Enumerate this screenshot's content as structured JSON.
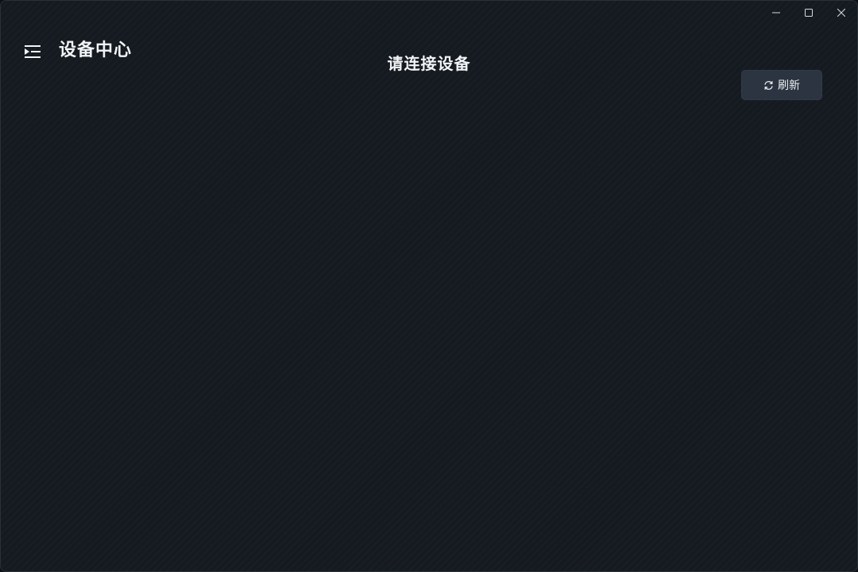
{
  "window": {
    "caption": {
      "minimize_icon": "minimize-icon",
      "maximize_icon": "maximize-icon",
      "close_icon": "close-icon"
    }
  },
  "header": {
    "menu_icon": "menu-expand-icon",
    "app_title": "设备中心"
  },
  "main": {
    "status_heading": "请连接设备",
    "refresh_button": {
      "icon": "refresh-icon",
      "label": "刷新"
    }
  },
  "colors": {
    "background": "#141a20",
    "button": "#2b3440",
    "text": "#f2f4f6"
  }
}
